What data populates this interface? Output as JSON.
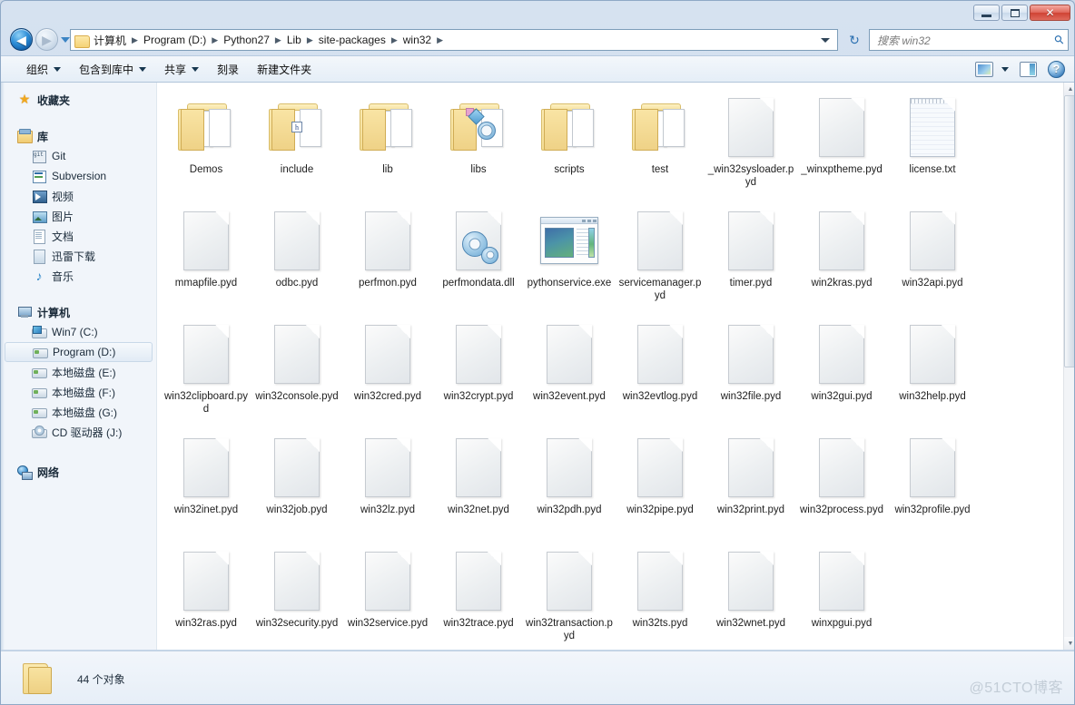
{
  "window": {
    "controls": {
      "minimize": "–",
      "maximize": "□",
      "close": "✕"
    }
  },
  "address": {
    "back_label": "◀",
    "forward_label": "▶",
    "history_dropdown": "▼",
    "folder_icon": "folder-icon",
    "crumbs": [
      "计算机",
      "Program (D:)",
      "Python27",
      "Lib",
      "site-packages",
      "win32"
    ],
    "separator": "▶",
    "dropdown": "▼",
    "refresh_label": "↻"
  },
  "search": {
    "placeholder": "搜索 win32",
    "icon": "search-icon"
  },
  "toolbar": {
    "organize": "组织",
    "include_in_library": "包含到库中",
    "share": "共享",
    "burn": "刻录",
    "new_folder": "新建文件夹",
    "help_label": "?"
  },
  "sidebar": {
    "favorites": {
      "label": "收藏夹",
      "icon": "star-icon"
    },
    "libraries": {
      "label": "库",
      "icon": "library-icon",
      "items": [
        {
          "label": "Git",
          "icon": "git-icon"
        },
        {
          "label": "Subversion",
          "icon": "subversion-icon"
        },
        {
          "label": "视频",
          "icon": "video-icon"
        },
        {
          "label": "图片",
          "icon": "pictures-icon"
        },
        {
          "label": "文档",
          "icon": "documents-icon"
        },
        {
          "label": "迅雷下载",
          "icon": "download-icon"
        },
        {
          "label": "音乐",
          "icon": "music-icon"
        }
      ]
    },
    "computer": {
      "label": "计算机",
      "icon": "computer-icon",
      "items": [
        {
          "label": "Win7 (C:)",
          "icon": "windows-drive-icon",
          "selected": false
        },
        {
          "label": "Program (D:)",
          "icon": "drive-icon",
          "selected": true
        },
        {
          "label": "本地磁盘 (E:)",
          "icon": "drive-icon",
          "selected": false
        },
        {
          "label": "本地磁盘 (F:)",
          "icon": "drive-icon",
          "selected": false
        },
        {
          "label": "本地磁盘 (G:)",
          "icon": "drive-icon",
          "selected": false
        },
        {
          "label": "CD 驱动器 (J:)",
          "icon": "cd-drive-icon",
          "selected": false
        }
      ]
    },
    "network": {
      "label": "网络",
      "icon": "network-icon"
    }
  },
  "files": [
    {
      "name": "Demos",
      "type": "folder",
      "preview": "papers"
    },
    {
      "name": "include",
      "type": "folder",
      "preview": "header"
    },
    {
      "name": "lib",
      "type": "folder",
      "preview": "papers"
    },
    {
      "name": "libs",
      "type": "folder",
      "preview": "mixed"
    },
    {
      "name": "scripts",
      "type": "folder",
      "preview": "papers"
    },
    {
      "name": "test",
      "type": "folder",
      "preview": "papers"
    },
    {
      "name": "_win32sysloader.pyd",
      "type": "file"
    },
    {
      "name": "_winxptheme.pyd",
      "type": "file"
    },
    {
      "name": "license.txt",
      "type": "text"
    },
    {
      "name": "mmapfile.pyd",
      "type": "file"
    },
    {
      "name": "odbc.pyd",
      "type": "file"
    },
    {
      "name": "perfmon.pyd",
      "type": "file"
    },
    {
      "name": "perfmondata.dll",
      "type": "dll"
    },
    {
      "name": "pythonservice.exe",
      "type": "exe"
    },
    {
      "name": "servicemanager.pyd",
      "type": "file"
    },
    {
      "name": "timer.pyd",
      "type": "file"
    },
    {
      "name": "win2kras.pyd",
      "type": "file"
    },
    {
      "name": "win32api.pyd",
      "type": "file"
    },
    {
      "name": "win32clipboard.pyd",
      "type": "file"
    },
    {
      "name": "win32console.pyd",
      "type": "file"
    },
    {
      "name": "win32cred.pyd",
      "type": "file"
    },
    {
      "name": "win32crypt.pyd",
      "type": "file"
    },
    {
      "name": "win32event.pyd",
      "type": "file"
    },
    {
      "name": "win32evtlog.pyd",
      "type": "file"
    },
    {
      "name": "win32file.pyd",
      "type": "file"
    },
    {
      "name": "win32gui.pyd",
      "type": "file"
    },
    {
      "name": "win32help.pyd",
      "type": "file"
    },
    {
      "name": "win32inet.pyd",
      "type": "file"
    },
    {
      "name": "win32job.pyd",
      "type": "file"
    },
    {
      "name": "win32lz.pyd",
      "type": "file"
    },
    {
      "name": "win32net.pyd",
      "type": "file"
    },
    {
      "name": "win32pdh.pyd",
      "type": "file"
    },
    {
      "name": "win32pipe.pyd",
      "type": "file"
    },
    {
      "name": "win32print.pyd",
      "type": "file"
    },
    {
      "name": "win32process.pyd",
      "type": "file"
    },
    {
      "name": "win32profile.pyd",
      "type": "file"
    },
    {
      "name": "win32ras.pyd",
      "type": "file"
    },
    {
      "name": "win32security.pyd",
      "type": "file"
    },
    {
      "name": "win32service.pyd",
      "type": "file"
    },
    {
      "name": "win32trace.pyd",
      "type": "file"
    },
    {
      "name": "win32transaction.pyd",
      "type": "file"
    },
    {
      "name": "win32ts.pyd",
      "type": "file"
    },
    {
      "name": "win32wnet.pyd",
      "type": "file"
    },
    {
      "name": "winxpgui.pyd",
      "type": "file"
    }
  ],
  "status": {
    "count_text": "44 个对象",
    "folder_icon": "folder-icon"
  },
  "watermark": "@51CTO博客",
  "colors": {
    "accent": "#2a6fb0",
    "folder": "#f3dc94",
    "close_button": "#cf4334",
    "selection": "#e2ebf5"
  }
}
